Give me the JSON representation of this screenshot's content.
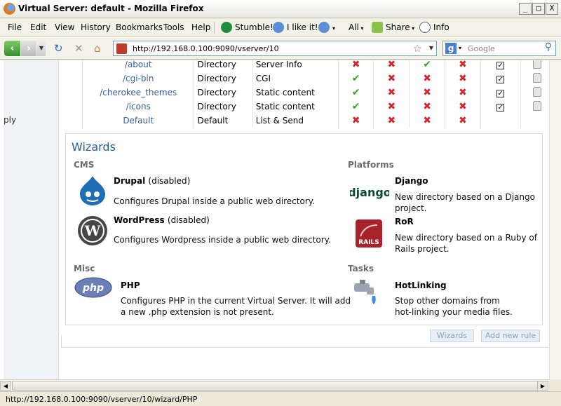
{
  "window": {
    "title": "Virtual Server: default - Mozilla Firefox",
    "min": "_",
    "max": "□",
    "close": "X"
  },
  "menubar": {
    "items": [
      "File",
      "Edit",
      "View",
      "History",
      "Bookmarks",
      "Tools",
      "Help"
    ],
    "stumble": "Stumble!",
    "like": "I like it!",
    "all": "All",
    "share": "Share",
    "info": "Info"
  },
  "navbar": {
    "url": "http://192.168.0.100:9090/vserver/10",
    "search_placeholder": "Google"
  },
  "leftpane": {
    "partial_text": "ply"
  },
  "rules": [
    {
      "name": "/about",
      "type": "Directory",
      "handler": "Server Info",
      "flags": [
        "x",
        "x",
        "v",
        "x"
      ],
      "checked": true,
      "lock": true
    },
    {
      "name": "/cgi-bin",
      "type": "Directory",
      "handler": "CGI",
      "flags": [
        "v",
        "x",
        "x",
        "x"
      ],
      "checked": true,
      "lock": true
    },
    {
      "name": "/cherokee_themes",
      "type": "Directory",
      "handler": "Static content",
      "flags": [
        "v",
        "x",
        "x",
        "x"
      ],
      "checked": true,
      "lock": true
    },
    {
      "name": "/icons",
      "type": "Directory",
      "handler": "Static content",
      "flags": [
        "v",
        "x",
        "x",
        "x"
      ],
      "checked": true,
      "lock": true
    },
    {
      "name": "Default",
      "type": "Default",
      "handler": "List & Send",
      "flags": [
        "x",
        "x",
        "x",
        "x"
      ],
      "checked": false,
      "lock": false
    }
  ],
  "wizards": {
    "title": "Wizards",
    "categories": {
      "cms": "CMS",
      "platforms": "Platforms",
      "misc": "Misc",
      "tasks": "Tasks"
    },
    "drupal": {
      "name": "Drupal",
      "state": "(disabled)",
      "desc": "Configures Drupal inside a public web directory."
    },
    "wordpress": {
      "name": "WordPress",
      "state": "(disabled)",
      "desc": "Configures Wordpress inside a public web directory."
    },
    "django": {
      "name": "Django",
      "logo": "django",
      "desc1": "New directory based on a Django",
      "desc2": "project."
    },
    "ror": {
      "name": "RoR",
      "logo": "RAILS",
      "desc1": "New directory based on a Ruby of",
      "desc2": "Rails project."
    },
    "php": {
      "name": "PHP",
      "logo": "php",
      "desc1": "Configures PHP in the current Virtual Server. It will add",
      "desc2": "a new .php extension is not present."
    },
    "hotlinking": {
      "name": "HotLinking",
      "desc1": "Stop other domains from",
      "desc2": "hot-linking your media files."
    }
  },
  "buttons": {
    "wizards": "Wizards",
    "add_rule": "Add new rule"
  },
  "status": {
    "text": "http://192.168.0.100:9090/vserver/10/wizard/PHP"
  }
}
